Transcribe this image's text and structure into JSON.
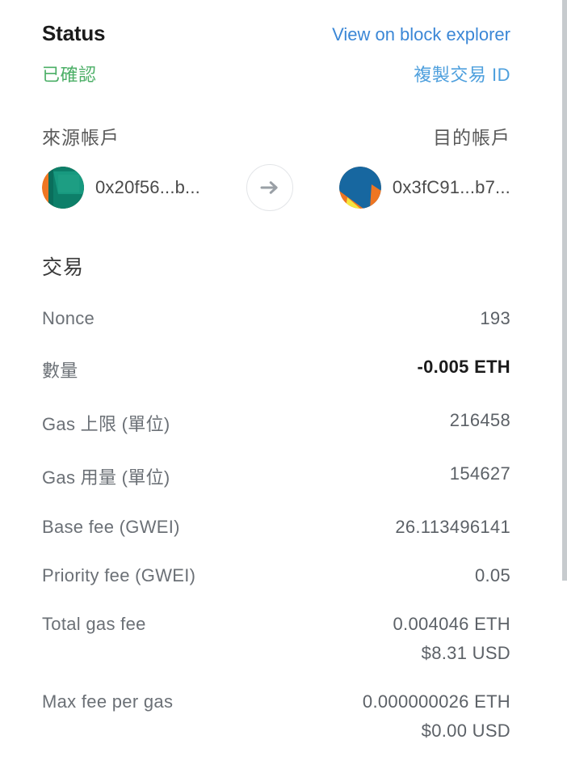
{
  "header": {
    "status_title": "Status",
    "explorer_link": "View on block explorer",
    "status_value": "已確認",
    "copy_link": "複製交易 ID",
    "status_color": "#4caf67",
    "link_color": "#3b87d6"
  },
  "accounts": {
    "from_label": "來源帳戶",
    "to_label": "目的帳戶",
    "from_address": "0x20f56...b...",
    "to_address": "0x3fC91...b7...",
    "arrow_icon": "arrow-right-icon",
    "from_avatar_colors": [
      "#ef7622",
      "#0c8f78",
      "#0a6e5c",
      "#2aa58b"
    ],
    "to_avatar_colors": [
      "#ef7622",
      "#1767a0",
      "#f5e63d",
      "#1d6f9e"
    ]
  },
  "transaction": {
    "section_title": "交易",
    "rows": [
      {
        "label": "Nonce",
        "value": "193",
        "sub": "",
        "strong": false
      },
      {
        "label": "數量",
        "value": "-0.005 ETH",
        "sub": "",
        "strong": true
      },
      {
        "label": "Gas 上限 (單位)",
        "value": "216458",
        "sub": "",
        "strong": false
      },
      {
        "label": "Gas 用量 (單位)",
        "value": "154627",
        "sub": "",
        "strong": false
      },
      {
        "label": "Base fee (GWEI)",
        "value": "26.113496141",
        "sub": "",
        "strong": false
      },
      {
        "label": "Priority fee (GWEI)",
        "value": "0.05",
        "sub": "",
        "strong": false
      },
      {
        "label": "Total gas fee",
        "value": "0.004046 ETH",
        "sub": "$8.31 USD",
        "strong": false
      },
      {
        "label": "Max fee per gas",
        "value": "0.000000026 ETH",
        "sub": "$0.00 USD",
        "strong": false
      }
    ]
  },
  "scrollbar": {
    "thumb_color": "#c7cbce"
  }
}
